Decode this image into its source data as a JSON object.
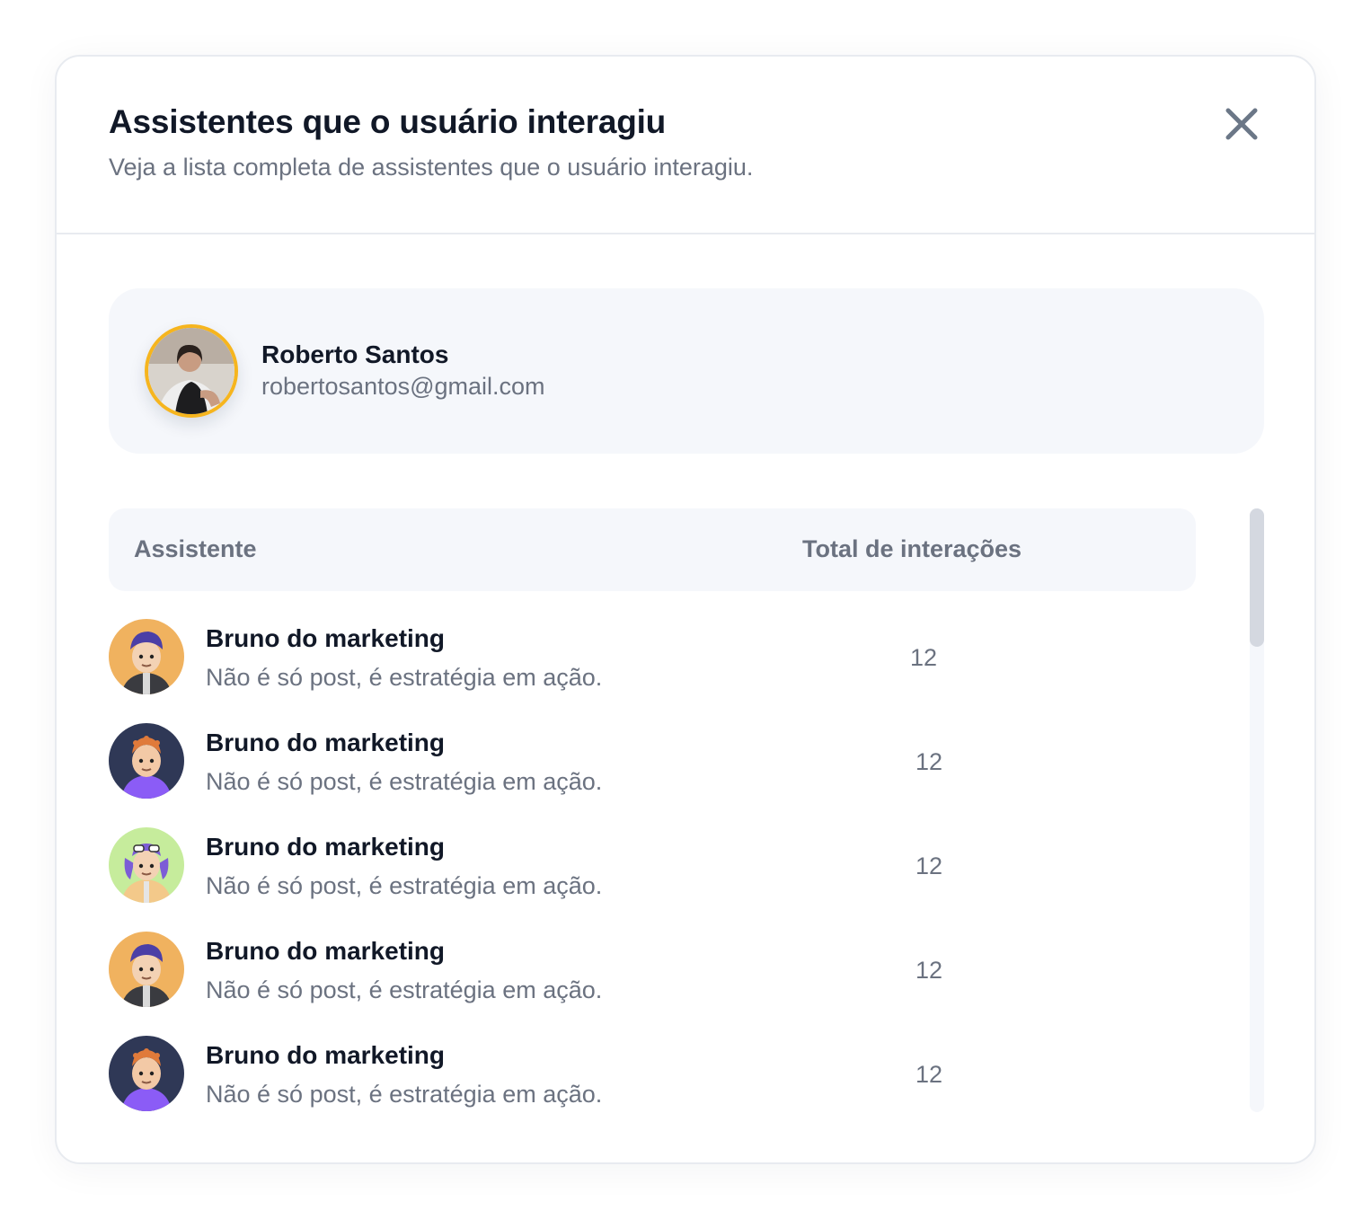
{
  "modal": {
    "title": "Assistentes que o usuário interagiu",
    "subtitle": "Veja a lista completa de assistentes que o usuário interagiu.",
    "close_icon": "close-icon"
  },
  "user": {
    "name": "Roberto Santos",
    "email": "robertosantos@gmail.com",
    "avatar_ring_color": "#f6b51e"
  },
  "table": {
    "headers": {
      "assistant": "Assistente",
      "total": "Total de interações"
    },
    "rows": [
      {
        "name": "Bruno do marketing",
        "description": "Não é só post, é estratégia em ação.",
        "count": "12",
        "avatar_bg": "#f0b25f"
      },
      {
        "name": "Bruno do marketing",
        "description": "Não é só post, é estratégia em ação.",
        "count": "12",
        "avatar_bg": "#2f3856"
      },
      {
        "name": "Bruno do marketing",
        "description": "Não é só post, é estratégia em ação.",
        "count": "12",
        "avatar_bg": "#c6ec9c"
      },
      {
        "name": "Bruno do marketing",
        "description": "Não é só post, é estratégia em ação.",
        "count": "12",
        "avatar_bg": "#f0b25f"
      },
      {
        "name": "Bruno do marketing",
        "description": "Não é só post, é estratégia em ação.",
        "count": "12",
        "avatar_bg": "#2f3856"
      }
    ]
  },
  "colors": {
    "text_primary": "#111827",
    "text_secondary": "#6b7280",
    "surface": "#f5f7fb",
    "border": "#e8ebf0"
  }
}
